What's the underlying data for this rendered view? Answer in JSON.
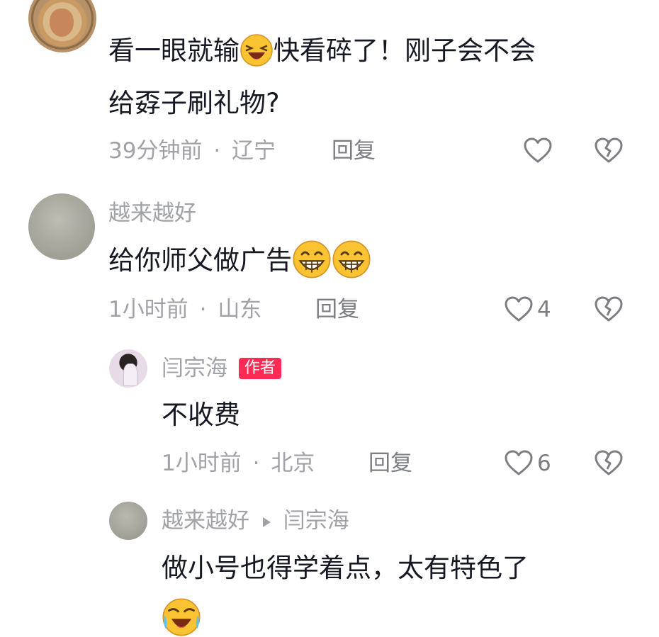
{
  "comments": [
    {
      "id": "c1",
      "username": "",
      "text_a": "看一眼就输",
      "emoji_a": "laughing-tears-emoji",
      "text_b": "快看碎了！刚子会不会",
      "text_line2": "给孬子刷礼物?",
      "time": "39分钟前",
      "location": "辽宁",
      "reply_label": "回复",
      "likes": ""
    },
    {
      "id": "c2",
      "username": "越来越好",
      "text_a": "给你师父做广告",
      "emoji_a": "grinning-emoji",
      "time": "1小时前",
      "location": "山东",
      "reply_label": "回复",
      "likes": "4"
    },
    {
      "id": "c3",
      "username": "闫宗海",
      "author_badge": "作者",
      "text_a": "不收费",
      "time": "1小时前",
      "location": "北京",
      "reply_label": "回复",
      "likes": "6"
    },
    {
      "id": "c4",
      "username": "越来越好",
      "reply_to": "闫宗海",
      "text_a": "做小号也得学着点，太有特色了",
      "emoji_line2": "crying-laughing-emoji"
    }
  ],
  "separator": "·",
  "icons": {
    "like": "heart-outline-icon",
    "dislike": "broken-heart-icon",
    "reply_arrow": "triangle-right-icon"
  },
  "colors": {
    "text": "#161823",
    "muted": "#a1a2a7",
    "badge": "#fe2c55"
  }
}
